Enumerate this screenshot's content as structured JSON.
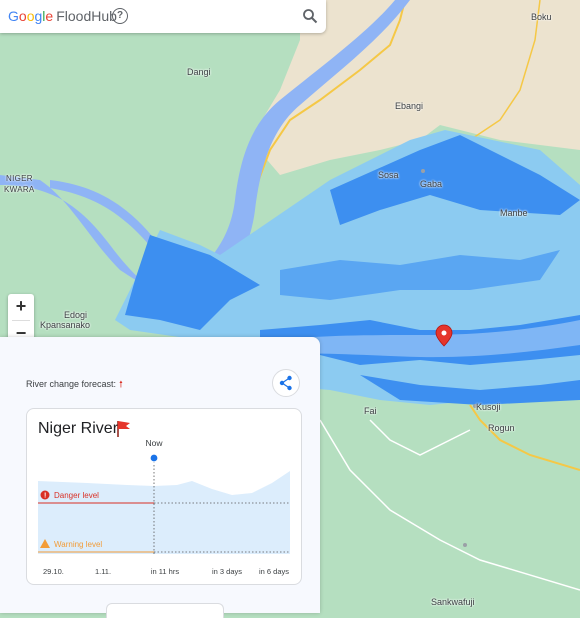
{
  "header": {
    "logo_google": [
      "G",
      "o",
      "o",
      "g",
      "l",
      "e"
    ],
    "logo_product": "FloodHub",
    "help_icon": "help-circle-icon",
    "search_icon": "search-icon"
  },
  "map": {
    "places": {
      "boku": "Boku",
      "dangi": "Dangi",
      "ebangi": "Ebangi",
      "niger": "NIGER",
      "kwara": "KWARA",
      "sosa": "Sosa",
      "gaba": "Gaba",
      "manbe": "Manbe",
      "edogi": "Edogi",
      "kpansanako": "Kpansanako",
      "fai": "Fai",
      "kusoji": "Kusoji",
      "rogun": "Rogun",
      "sankwafuji": "Sankwafuji"
    },
    "colors": {
      "land": "#b5dfc0",
      "savanna": "#ece3cf",
      "river": "#8fb4f5",
      "flood_dark": "#3d8ff0",
      "flood_light": "#8ccbf1",
      "road": "#f5c846",
      "marker": "#e5352b"
    }
  },
  "zoom": {
    "in_label": "+",
    "out_label": "−"
  },
  "panel": {
    "forecast_label": "River change forecast:",
    "forecast_arrow": "🠕",
    "share_icon": "share-icon",
    "card": {
      "title": "Niger River",
      "flag_icon": "red-flag-icon"
    }
  },
  "chart_data": {
    "type": "area",
    "now_label": "Now",
    "x_ticks": [
      "29.10.",
      "1.11.",
      "in 11 hrs",
      "in 3 days",
      "in 6 days"
    ],
    "levels": [
      {
        "name": "Danger level",
        "color": "#d93025"
      },
      {
        "name": "Warning level",
        "color": "#f29c38"
      }
    ],
    "series": [
      {
        "x": [
          "29.10.",
          "1.11.",
          "in 11 hrs",
          "in 3 days",
          "in 6 days"
        ]
      }
    ]
  }
}
